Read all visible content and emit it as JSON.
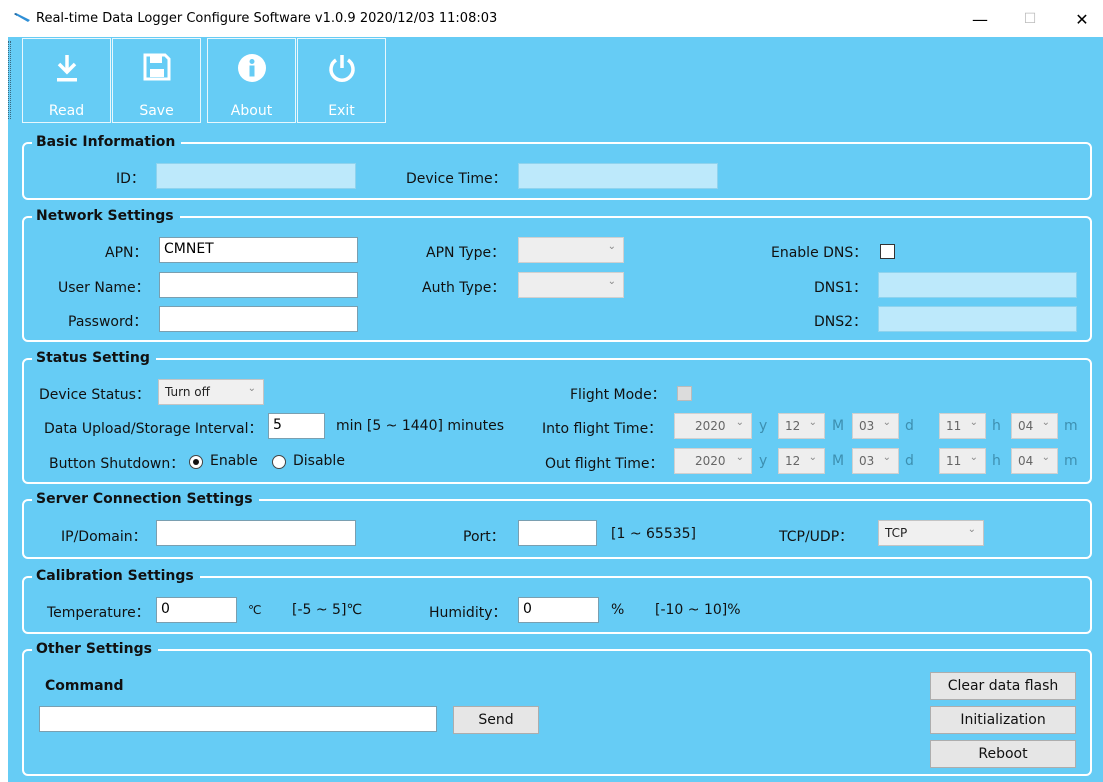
{
  "window": {
    "title": "Real-time Data Logger Configure Software v1.0.9  2020/12/03 11:08:03",
    "minimize": "—",
    "maximize": "☐",
    "close": "✕"
  },
  "toolbar": {
    "read": "Read",
    "save": "Save",
    "about": "About",
    "exit": "Exit"
  },
  "basic": {
    "title": "Basic Information",
    "id_label": "ID：",
    "id_value": "",
    "device_time_label": "Device Time：",
    "device_time_value": ""
  },
  "network": {
    "title": "Network Settings",
    "apn_label": "APN：",
    "apn_value": "CMNET",
    "username_label": "User Name：",
    "username_value": "",
    "password_label": "Password：",
    "password_value": "",
    "apn_type_label": "APN Type：",
    "apn_type_value": "",
    "auth_type_label": "Auth Type：",
    "auth_type_value": "",
    "enable_dns_label": "Enable DNS：",
    "dns1_label": "DNS1：",
    "dns1_value": "",
    "dns2_label": "DNS2：",
    "dns2_value": ""
  },
  "status": {
    "title": "Status Setting",
    "device_status_label": "Device Status：",
    "device_status_value": "Turn off",
    "interval_label": "Data Upload/Storage Interval：",
    "interval_value": "5",
    "interval_hint": "min  [5 ~ 1440] minutes",
    "shutdown_label": "Button Shutdown：",
    "enable_label": "Enable",
    "disable_label": "Disable",
    "flight_mode_label": "Flight Mode：",
    "into_flight_label": "Into flight Time：",
    "out_flight_label": "Out flight Time：",
    "into": {
      "year": "2020",
      "month": "12",
      "day": "03",
      "hour": "11",
      "minute": "04"
    },
    "out": {
      "year": "2020",
      "month": "12",
      "day": "03",
      "hour": "11",
      "minute": "04"
    },
    "unit_y": "y",
    "unit_M": "M",
    "unit_d": "d",
    "unit_h": "h",
    "unit_m": "m"
  },
  "server": {
    "title": "Server Connection Settings",
    "ip_label": "IP/Domain：",
    "ip_value": "",
    "port_label": "Port：",
    "port_value": "",
    "port_hint": "[1 ~ 65535]",
    "proto_label": "TCP/UDP：",
    "proto_value": "TCP"
  },
  "calibration": {
    "title": "Calibration Settings",
    "temp_label": "Temperature：",
    "temp_value": "0",
    "temp_unit": "℃",
    "temp_hint": "[-5 ~ 5]℃",
    "hum_label": "Humidity：",
    "hum_value": "0",
    "hum_unit": "%",
    "hum_hint": "[-10 ~ 10]%"
  },
  "other": {
    "title": "Other Settings",
    "command_label": "Command",
    "command_value": "",
    "send": "Send",
    "clear_flash": "Clear data flash",
    "initialization": "Initialization",
    "reboot": "Reboot"
  }
}
